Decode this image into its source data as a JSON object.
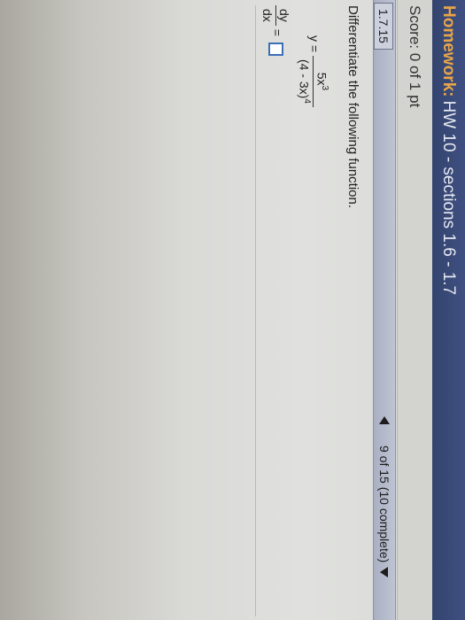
{
  "header": {
    "prefix": "Homework:",
    "title": "HW 10 - sections 1.6 - 1.7"
  },
  "score": {
    "text": "Score: 0 of 1 pt"
  },
  "question_bar": {
    "number": "1.7.15",
    "progress": "9 of 15 (10 complete)",
    "prev_icon": "triangle-left-icon",
    "menu_icon": "triangle-down-icon"
  },
  "problem": {
    "instruction": "Differentiate the following function.",
    "lhs": "y =",
    "numerator_base": "5x",
    "numerator_exp": "3",
    "denominator_base": "(4 - 3x)",
    "denominator_exp": "4",
    "answer_num": "dy",
    "answer_den": "dx",
    "equals": "=",
    "answer_value": ""
  },
  "colors": {
    "title_bg": "#3a4a78",
    "homework_accent": "#e7a54a",
    "answer_box_border": "#3c6fb6"
  }
}
